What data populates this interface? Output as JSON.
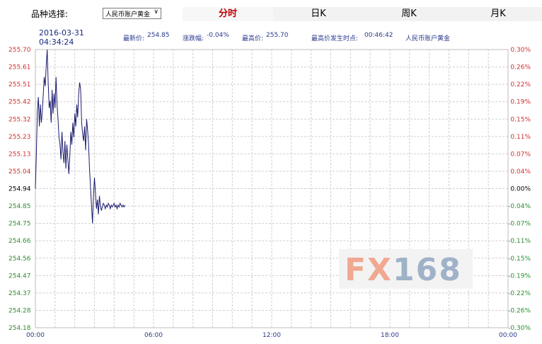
{
  "selector": {
    "label": "品种选择:",
    "value": "人民币账户黄金"
  },
  "tabs": [
    {
      "label": "分时",
      "active": true
    },
    {
      "label": "日K",
      "active": false
    },
    {
      "label": "周K",
      "active": false
    },
    {
      "label": "月K",
      "active": false
    }
  ],
  "header": {
    "date": "2016-03-31",
    "time": "04:34:24",
    "latest_label": "最新价:",
    "latest_value": "254.85",
    "change_label": "涨跌幅:",
    "change_value": "-0.04%",
    "high_label": "最高价:",
    "high_value": "255.70",
    "high_time_label": "最高价发生时点:",
    "high_time_value": "00:46:42",
    "product": "人民币账户黄金"
  },
  "watermark": "FX168",
  "colors": {
    "up": "#d03030",
    "down": "#2e8b2e",
    "neutral": "#000000",
    "line": "#1a1a6e",
    "grid": "#cfcfcf"
  },
  "chart_data": {
    "type": "line",
    "title": "",
    "xlabel": "",
    "ylabel": "",
    "x_ticks": [
      "00:00",
      "06:00",
      "12:00",
      "18:00",
      "00:00"
    ],
    "y_ticks": [
      "255.70",
      "255.61",
      "255.51",
      "255.42",
      "255.32",
      "255.23",
      "255.13",
      "255.04",
      "254.94",
      "254.85",
      "254.75",
      "254.66",
      "254.56",
      "254.47",
      "254.37",
      "254.28",
      "254.18"
    ],
    "right_ticks": [
      "0.30%",
      "0.26%",
      "0.22%",
      "0.19%",
      "0.15%",
      "0.11%",
      "0.07%",
      "0.04%",
      "0.00%",
      "-0.04%",
      "-0.07%",
      "-0.11%",
      "-0.15%",
      "-0.19%",
      "-0.22%",
      "-0.26%",
      "-0.30%"
    ],
    "ylim": [
      254.18,
      255.7
    ],
    "xlim_hours": [
      0,
      24
    ],
    "grid": true,
    "series": [
      {
        "x": [
          0.0,
          0.05,
          0.1,
          0.15,
          0.2,
          0.25,
          0.3,
          0.35,
          0.4,
          0.45,
          0.5,
          0.55,
          0.6,
          0.65,
          0.7,
          0.75,
          0.8,
          0.85,
          0.9,
          0.95,
          1.0,
          1.05,
          1.1,
          1.15,
          1.2,
          1.25,
          1.3,
          1.35,
          1.4,
          1.45,
          1.5,
          1.55,
          1.6,
          1.65,
          1.7,
          1.75,
          1.8,
          1.85,
          1.9,
          1.95,
          2.0,
          2.05,
          2.1,
          2.15,
          2.2,
          2.25,
          2.3,
          2.35,
          2.4,
          2.45,
          2.5,
          2.55,
          2.6,
          2.65,
          2.7,
          2.75,
          2.8,
          2.85,
          2.9,
          2.95,
          3.0,
          3.05,
          3.1,
          3.15,
          3.2,
          3.25,
          3.3,
          3.35,
          3.4,
          3.45,
          3.5,
          3.55,
          3.6,
          3.65,
          3.7,
          3.75,
          3.8,
          3.85,
          3.9,
          3.95,
          4.0,
          4.05,
          4.1,
          4.15,
          4.2,
          4.25,
          4.3,
          4.35,
          4.4,
          4.45,
          4.5,
          4.55
        ],
        "y": [
          254.94,
          255.13,
          255.36,
          255.44,
          255.28,
          255.4,
          255.3,
          255.36,
          255.45,
          255.55,
          255.5,
          255.61,
          255.7,
          255.52,
          255.38,
          255.42,
          255.3,
          255.48,
          255.35,
          255.46,
          255.38,
          255.55,
          255.4,
          255.32,
          255.22,
          255.18,
          255.1,
          255.25,
          255.14,
          255.08,
          255.2,
          255.05,
          255.18,
          255.1,
          255.02,
          255.12,
          255.25,
          255.18,
          255.3,
          255.22,
          255.35,
          255.28,
          255.4,
          255.33,
          255.46,
          255.52,
          255.48,
          255.3,
          255.24,
          255.2,
          255.28,
          255.15,
          255.32,
          255.26,
          255.18,
          255.05,
          254.95,
          254.85,
          254.75,
          254.9,
          255.0,
          254.92,
          254.83,
          254.88,
          254.8,
          254.9,
          254.85,
          254.82,
          254.84,
          254.86,
          254.85,
          254.83,
          254.85,
          254.84,
          254.86,
          254.85,
          254.83,
          254.85,
          254.84,
          254.85,
          254.86,
          254.84,
          254.85,
          254.83,
          254.85,
          254.84,
          254.86,
          254.85,
          254.84,
          254.85,
          254.84,
          254.85
        ]
      }
    ]
  }
}
